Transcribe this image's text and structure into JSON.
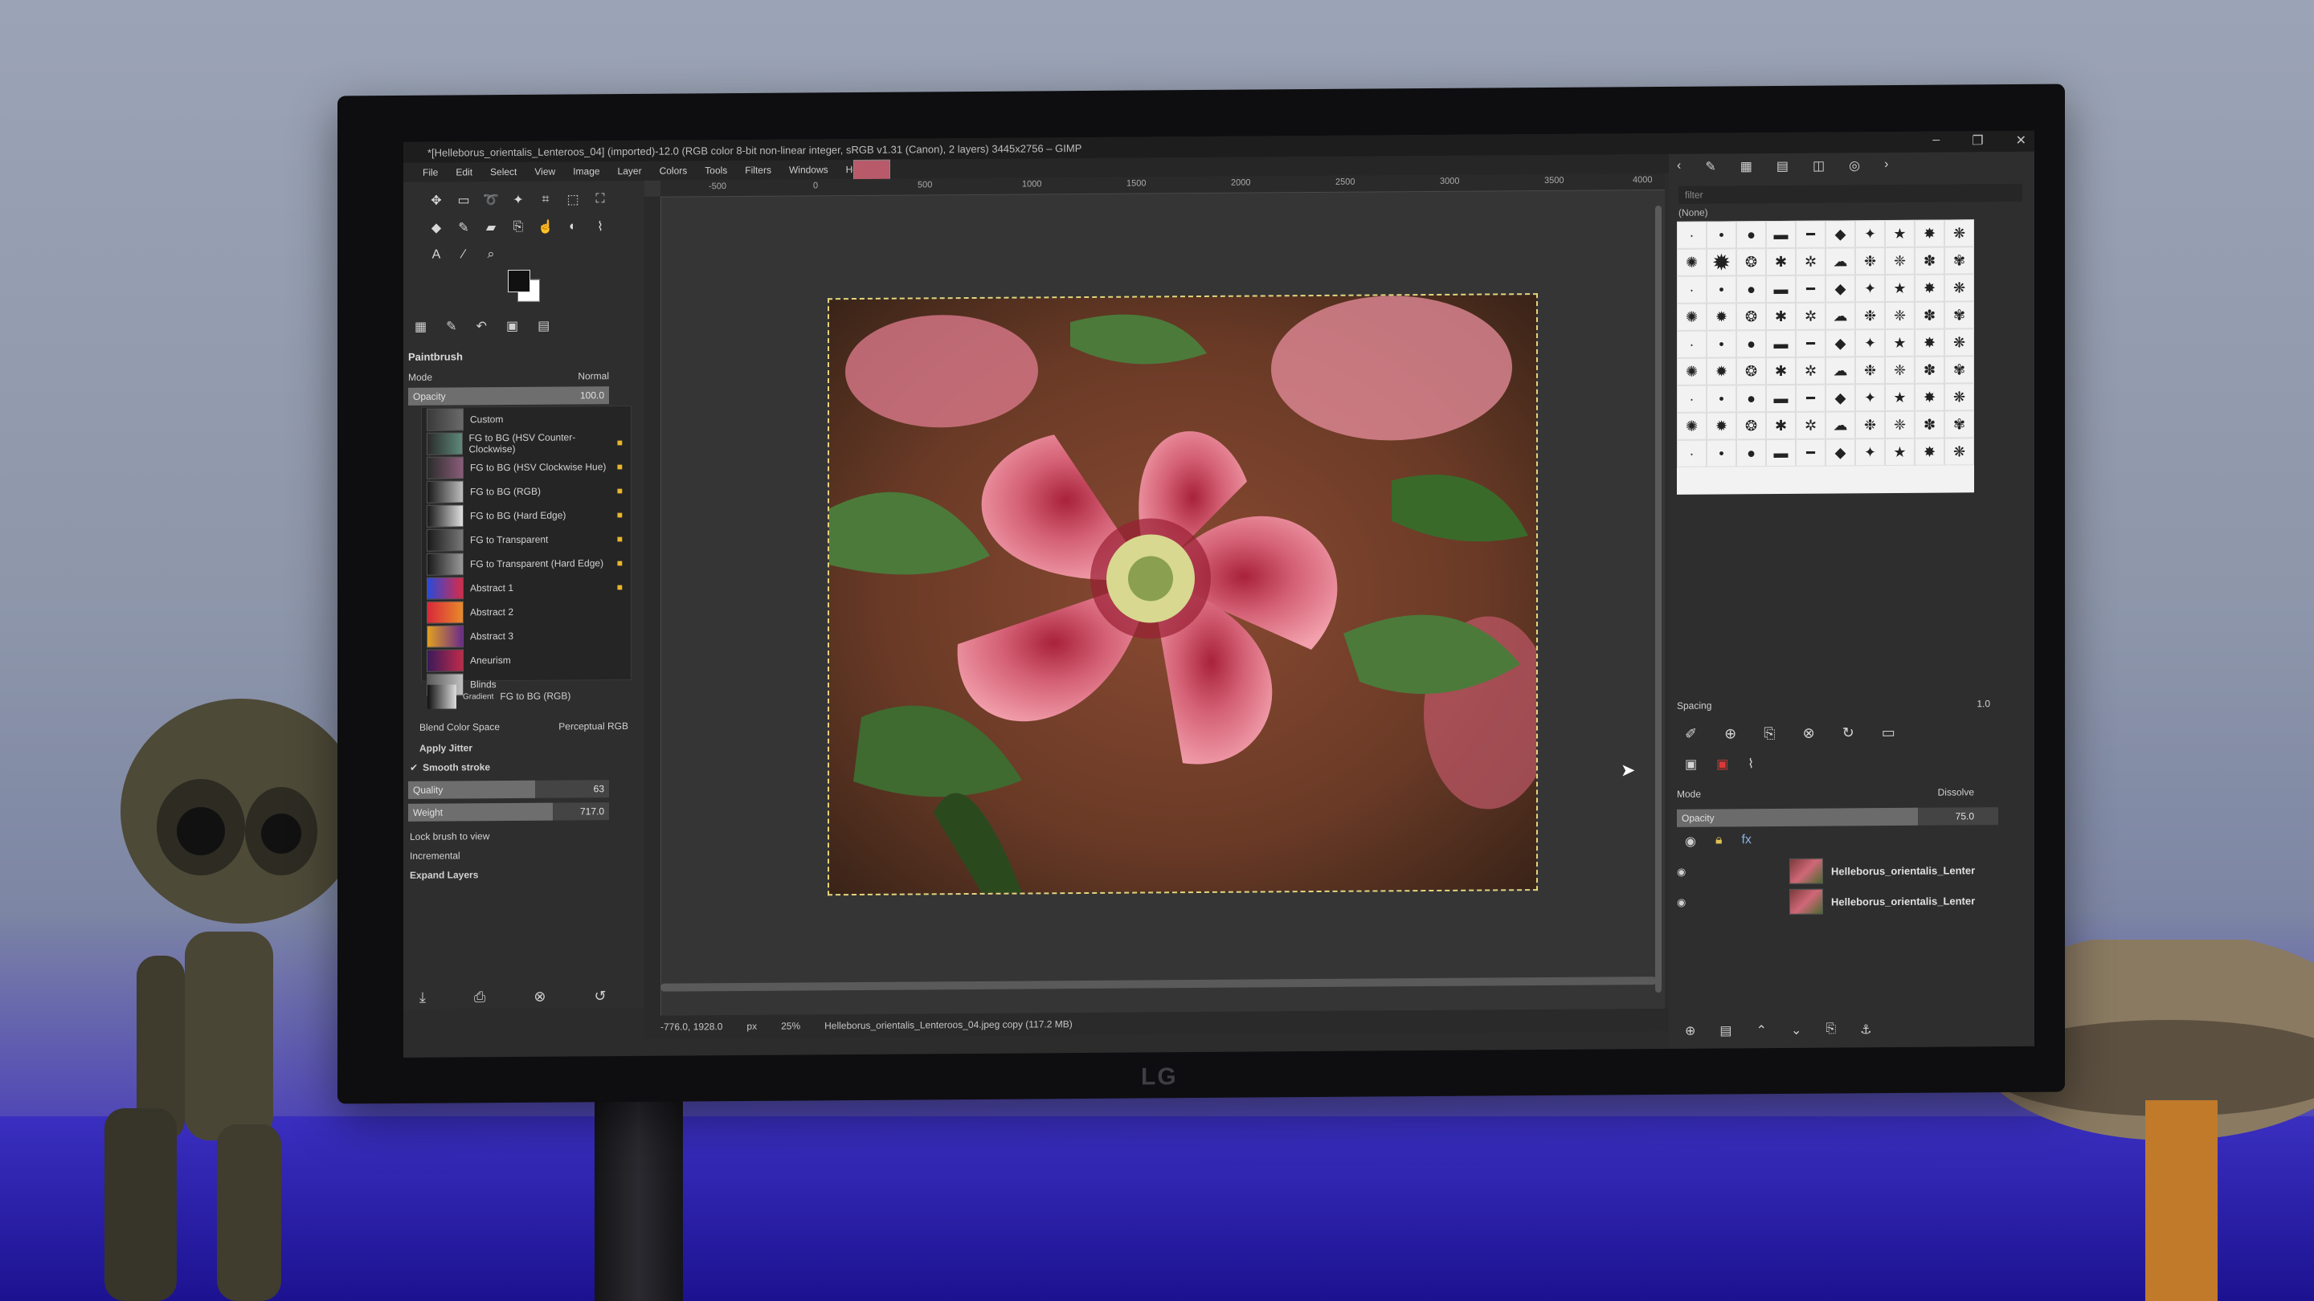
{
  "window": {
    "title": "*[Helleborus_orientalis_Lenteroos_04] (imported)-12.0 (RGB color 8-bit non-linear integer, sRGB v1.31 (Canon), 2 layers) 3445x2756 – GIMP",
    "minimize": "–",
    "maximize": "❐",
    "close": "✕"
  },
  "menu": [
    "File",
    "Edit",
    "Select",
    "View",
    "Image",
    "Layer",
    "Colors",
    "Tools",
    "Filters",
    "Windows",
    "Help"
  ],
  "toolbox": {
    "tool_name": "Paintbrush",
    "mode_label": "Mode",
    "mode_value": "Normal",
    "opacity_label": "Opacity",
    "opacity_value": "100.0",
    "opacity_percent": 100
  },
  "gradients": [
    {
      "name": "Custom",
      "colors": [
        "#3a3a3a",
        "#6a6a6a"
      ]
    },
    {
      "name": "FG to BG (HSV Counter-Clockwise)",
      "colors": [
        "#2b2b2b",
        "#5d8a7a"
      ]
    },
    {
      "name": "FG to BG (HSV Clockwise Hue)",
      "colors": [
        "#2b2b2b",
        "#8a5d7a"
      ]
    },
    {
      "name": "FG to BG (RGB)",
      "colors": [
        "#1a1a1a",
        "#bdbdbd"
      ]
    },
    {
      "name": "FG to BG (Hard Edge)",
      "colors": [
        "#1a1a1a",
        "#e0e0e0"
      ]
    },
    {
      "name": "FG to Transparent",
      "colors": [
        "#1a1a1a",
        "#777777"
      ]
    },
    {
      "name": "FG to Transparent (Hard Edge)",
      "colors": [
        "#1a1a1a",
        "#999999"
      ]
    },
    {
      "name": "Abstract 1",
      "colors": [
        "#2a4ad8",
        "#d82a4a"
      ]
    },
    {
      "name": "Abstract 2",
      "colors": [
        "#d8283a",
        "#e88a2a"
      ]
    },
    {
      "name": "Abstract 3",
      "colors": [
        "#e0a020",
        "#6a2a8a"
      ]
    },
    {
      "name": "Aneurism",
      "colors": [
        "#3a1a5a",
        "#c02a4a"
      ]
    },
    {
      "name": "Blinds",
      "colors": [
        "#5a5a5a",
        "#c0c0c0"
      ]
    }
  ],
  "gradient_opts": {
    "gradient_label": "Gradient",
    "gradient_value": "FG to BG (RGB)",
    "blend_label": "Blend Color Space",
    "blend_value": "Perceptual RGB",
    "apply_jitter": "Apply Jitter",
    "smooth_stroke": "Smooth stroke",
    "quality_label": "Quality",
    "quality_value": "63",
    "quality_percent": 63,
    "weight_label": "Weight",
    "weight_value": "717.0",
    "weight_percent": 72,
    "lock_brush": "Lock brush to view",
    "incremental": "Incremental",
    "expand_layers": "Expand Layers"
  },
  "ruler": [
    "-500",
    "0",
    "500",
    "1000",
    "1500",
    "2000",
    "2500",
    "3000",
    "3500",
    "4000"
  ],
  "status": {
    "coords": "-776.0, 1928.0",
    "unit": "px",
    "zoom": "25%",
    "file_info": "Helleborus_orientalis_Lenteroos_04.jpeg copy (117.2 MB)"
  },
  "dock": {
    "filter_placeholder": "filter",
    "none_label": "(None)",
    "spacing_label": "Spacing",
    "spacing_value": "1.0",
    "mode_label": "Mode",
    "mode_value": "Dissolve",
    "opacity_label": "Opacity",
    "opacity_value": "75.0",
    "opacity_percent": 75,
    "layers": [
      {
        "name": "Helleborus_orientalis_Lenter"
      },
      {
        "name": "Helleborus_orientalis_Lenter"
      }
    ]
  },
  "monitor_brand": "LG",
  "colors": {
    "ui_bg": "#2c2c2c",
    "accent": "#e8b82a",
    "flower_pink": "#d66878",
    "leaf_green": "#4c7a3a"
  }
}
